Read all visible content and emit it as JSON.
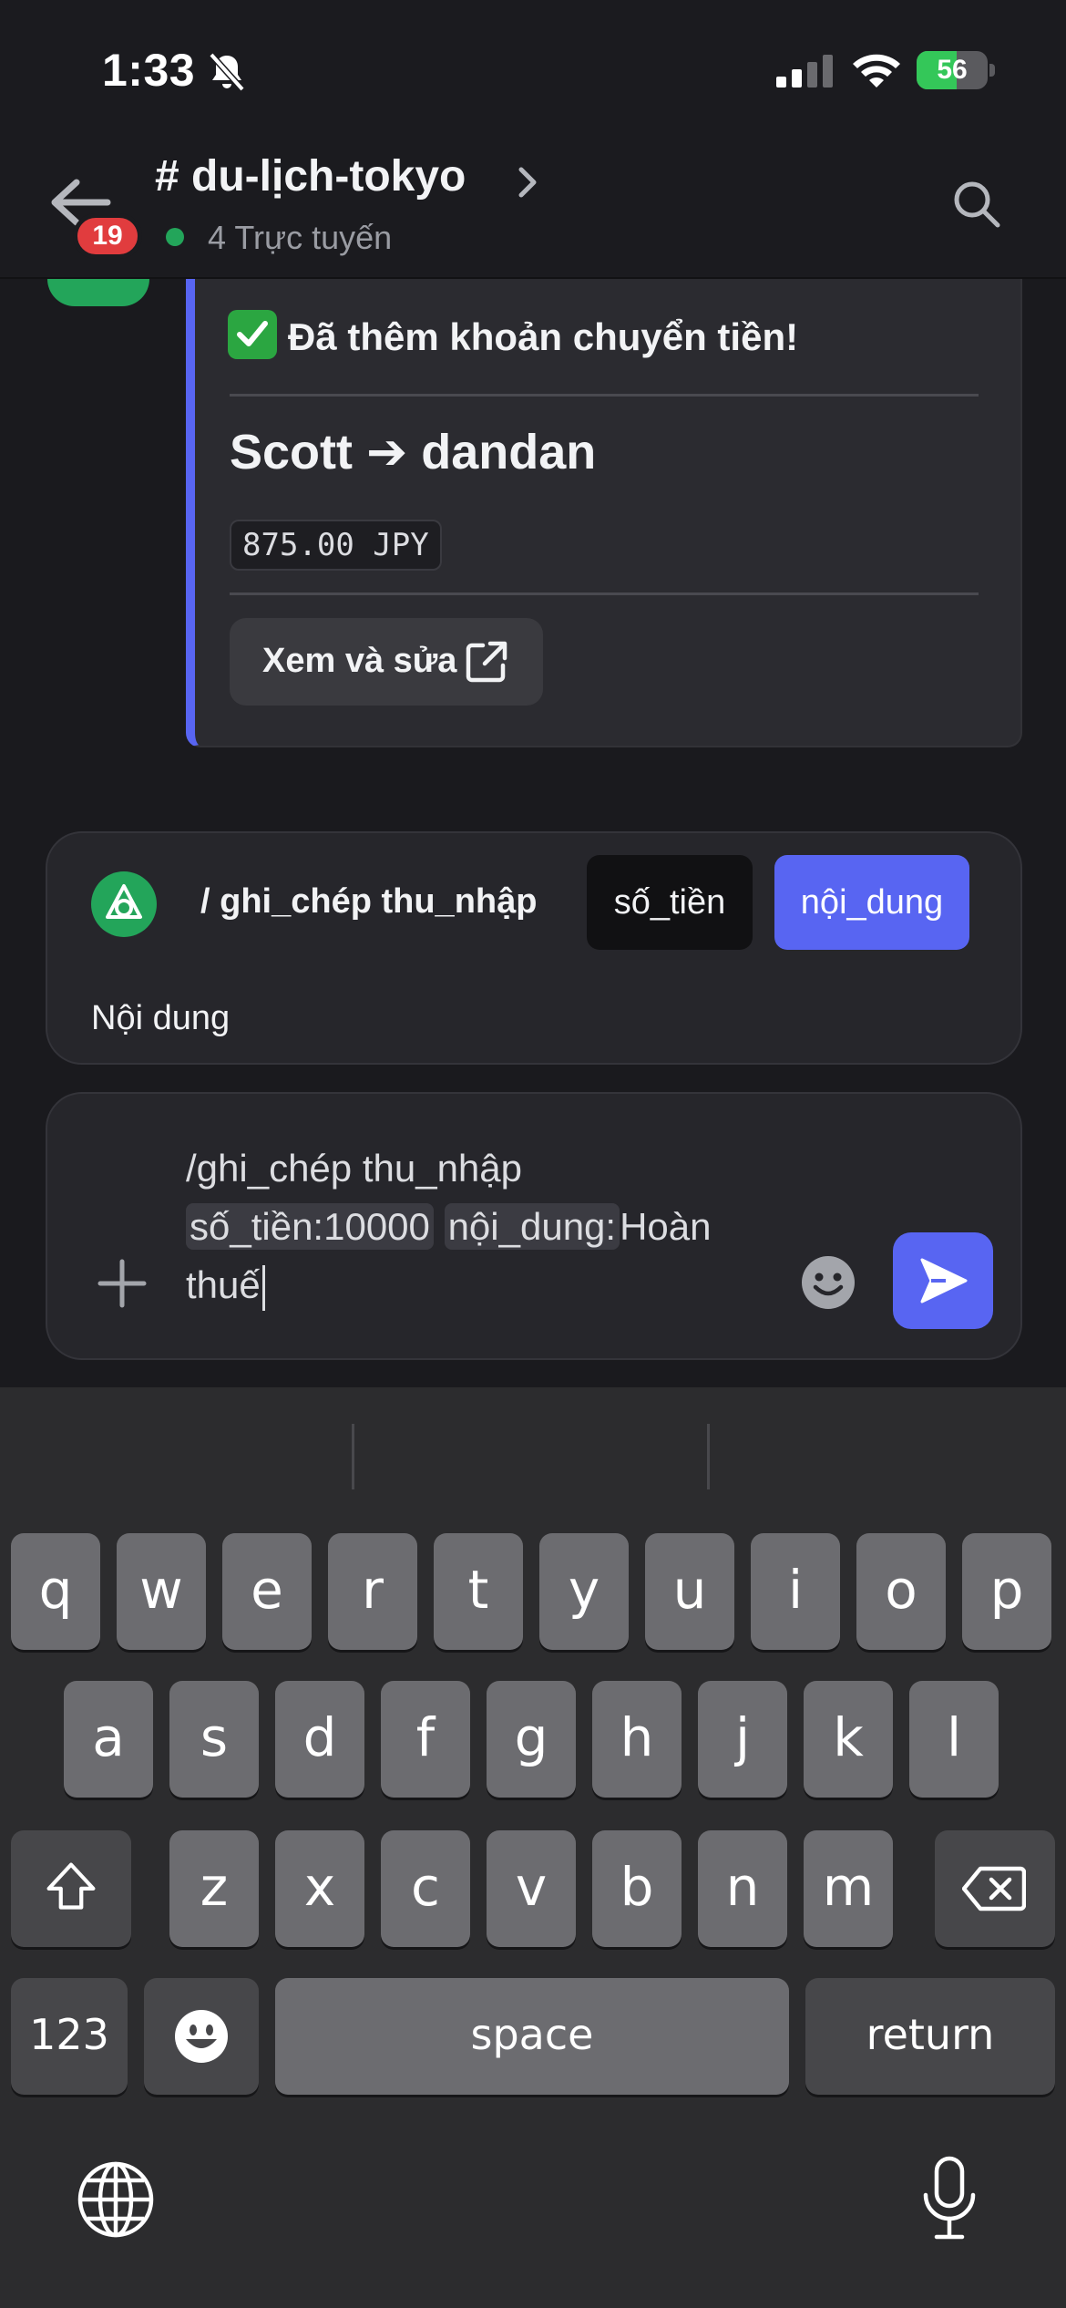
{
  "status_bar": {
    "time": "1:33",
    "battery_percent": "56",
    "battery_level": 0.56,
    "icons": [
      "bell-slash-icon",
      "cellular-signal-icon",
      "wifi-icon",
      "battery-charging-icon"
    ]
  },
  "header": {
    "channel_name": "# du-lịch-tokyo",
    "unread_count": "19",
    "online_status": "4 Trực tuyến",
    "icons": [
      "back-arrow-icon",
      "chevron-right-icon",
      "search-icon"
    ]
  },
  "embed": {
    "title": "Đã thêm khoản chuyển tiền!",
    "heading": "Scott ➔ dandan",
    "amount": "875.00 JPY",
    "button_label": "Xem và sửa",
    "accent_color": "#5865f2",
    "icons": [
      "check-mark-icon",
      "external-link-icon"
    ]
  },
  "command": {
    "name": "/ ghi_chép thu_nhập",
    "options": [
      "số_tiền",
      "nội_dung"
    ],
    "selected_option": "nội_dung",
    "description": "Nội dung"
  },
  "input": {
    "line1": "/ghi_chép thu_nhập",
    "opt1_label": "số_tiền:",
    "opt1_value": "10000",
    "opt2_label": "nội_dung:",
    "opt2_value": "Hoàn",
    "line3": "thuế",
    "icons": [
      "plus-icon",
      "emoji-icon",
      "send-icon"
    ]
  },
  "keyboard": {
    "row1": [
      "q",
      "w",
      "e",
      "r",
      "t",
      "y",
      "u",
      "i",
      "o",
      "p"
    ],
    "row2": [
      "a",
      "s",
      "d",
      "f",
      "g",
      "h",
      "j",
      "k",
      "l"
    ],
    "row3": [
      "z",
      "x",
      "c",
      "v",
      "b",
      "n",
      "m"
    ],
    "numbers_label": "123",
    "space_label": "space",
    "return_label": "return",
    "icons": [
      "shift-icon",
      "backspace-icon",
      "emoji-key-icon",
      "globe-icon",
      "microphone-icon"
    ]
  }
}
